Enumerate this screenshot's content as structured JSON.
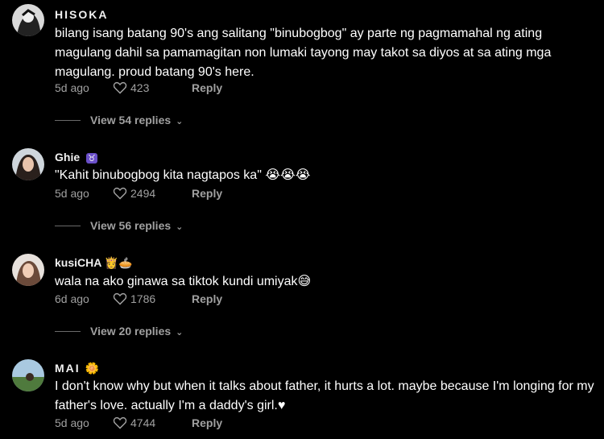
{
  "comments": [
    {
      "username": "HISOKA",
      "text": "bilang isang batang 90's ang salitang \"binubogbog\" ay parte ng pagmamahal ng ating magulang dahil sa pamamagitan non lumaki tayong may takot sa diyos at sa ating mga magulang. proud batang 90's here.",
      "time": "5d ago",
      "likes": "423",
      "reply": "Reply",
      "view_replies": "View 54 replies"
    },
    {
      "username": "Ghie",
      "badge": "♉",
      "text": "\"Kahit binubogbog kita nagtapos ka\" 😭😭😭",
      "time": "5d ago",
      "likes": "2494",
      "reply": "Reply",
      "view_replies": "View 56 replies"
    },
    {
      "username": "kusiCHA",
      "badge": "👸🥧",
      "text": "wala na ako ginawa sa tiktok kundi umiyak😅",
      "time": "6d ago",
      "likes": "1786",
      "reply": "Reply",
      "view_replies": "View 20 replies"
    },
    {
      "username": "MAI",
      "badge": "🌼",
      "text": "I don't know why but when it talks about father, it hurts a lot. maybe because I'm longing for my father's love. actually I'm a daddy's girl.♥",
      "time": "5d ago",
      "likes": "4744",
      "reply": "Reply"
    }
  ],
  "icons": {
    "like": "heart-outline-icon",
    "chevron": "chevron-down-icon"
  },
  "colors": {
    "background": "#000000",
    "text": "#ffffff",
    "muted": "#a0a0a0"
  }
}
